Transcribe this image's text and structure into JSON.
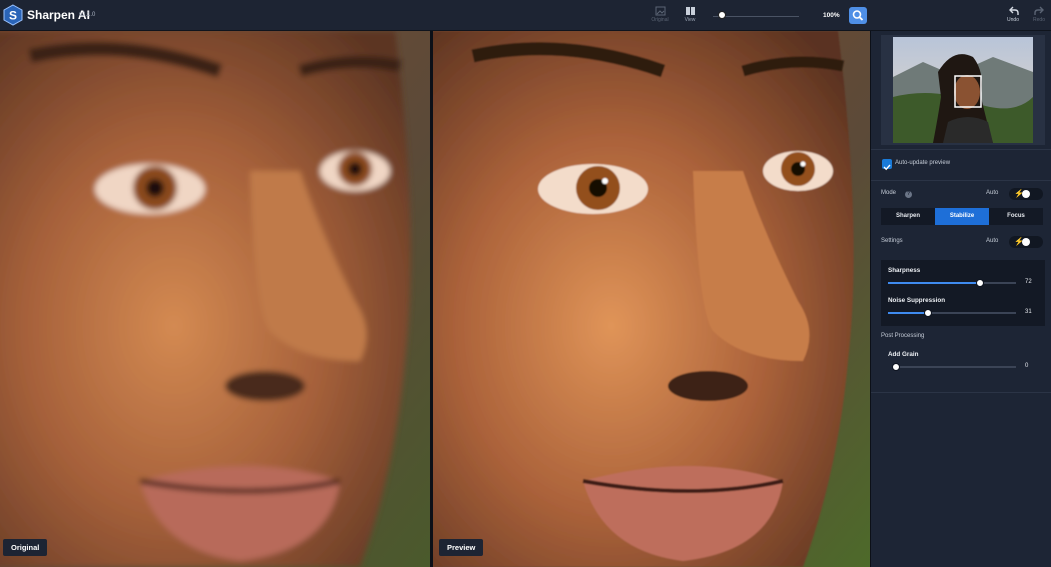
{
  "app": {
    "name": "Sharpen AI",
    "version": "v2.1.0"
  },
  "toolbar": {
    "original_label": "Original",
    "view_label": "View",
    "zoom_value": "100%",
    "zoom_level": 0.1,
    "undo_label": "Undo",
    "redo_label": "Redo"
  },
  "panes": {
    "left_label": "Original",
    "right_label": "Preview"
  },
  "side": {
    "auto_update_label": "Auto-update preview",
    "auto_update_checked": true,
    "mode_label": "Mode",
    "mode_auto_label": "Auto",
    "modes": [
      "Sharpen",
      "Stabilize",
      "Focus"
    ],
    "active_mode": "Stabilize",
    "settings_label": "Settings",
    "settings_auto_label": "Auto",
    "sharpness": {
      "label": "Sharpness",
      "value": "72",
      "fraction": 0.72
    },
    "noise": {
      "label": "Noise Suppression",
      "value": "31",
      "fraction": 0.31
    },
    "post_processing_label": "Post Processing",
    "grain": {
      "label": "Add Grain",
      "value": "0",
      "fraction": 0.0
    }
  },
  "colors": {
    "accent": "#1e6fd8",
    "panel": "#1d2535",
    "topbar": "#1d2433"
  }
}
